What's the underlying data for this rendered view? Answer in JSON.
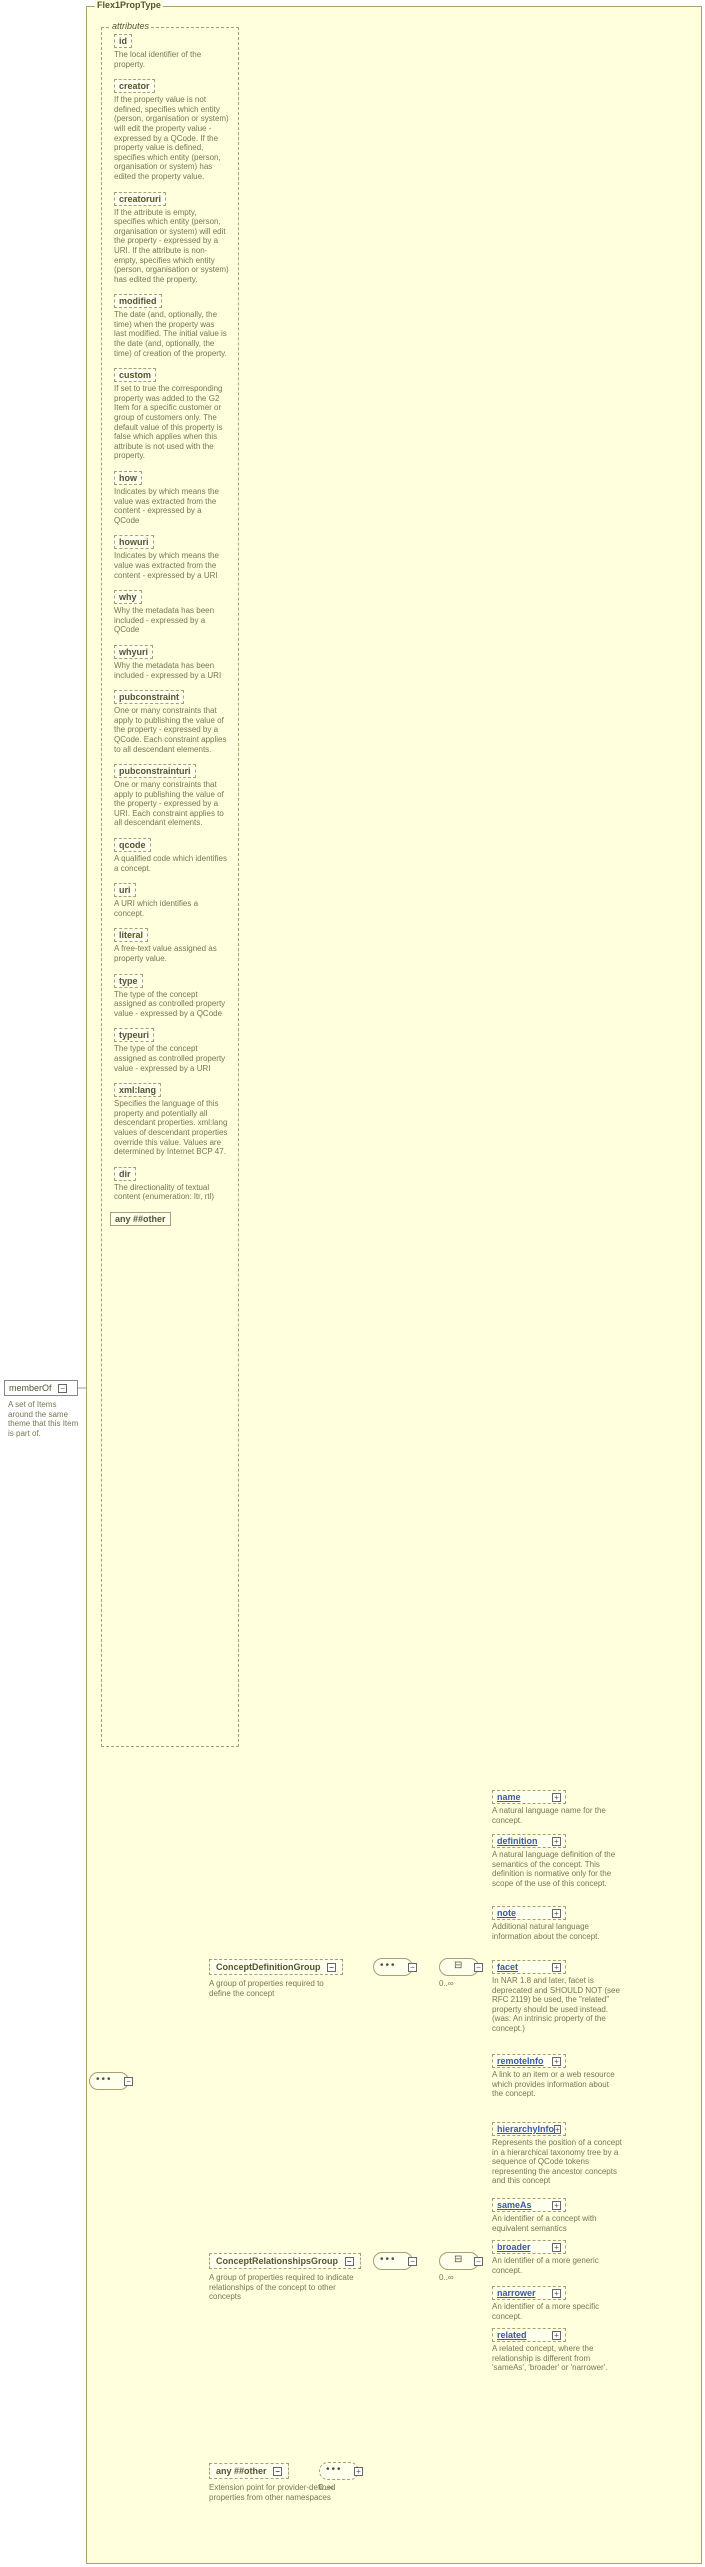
{
  "root": {
    "name": "memberOf",
    "desc": "A set of Items around the same theme that this Item is part of."
  },
  "panel": {
    "title": "Flex1PropType",
    "attributes_label": "attributes",
    "any_other": "any ##other",
    "attributes": [
      {
        "name": "id",
        "desc": "The local identifier of the property."
      },
      {
        "name": "creator",
        "desc": "If the property value is not defined, specifies which entity (person, organisation or system) will edit the property value - expressed by a QCode. If the property value is defined, specifies which entity (person, organisation or system) has edited the property value."
      },
      {
        "name": "creatoruri",
        "desc": "If the attribute is empty, specifies which entity (person, organisation or system) will edit the property - expressed by a URI. If the attribute is non-empty, specifies which entity (person, organisation or system) has edited the property."
      },
      {
        "name": "modified",
        "desc": "The date (and, optionally, the time) when the property was last modified. The initial value is the date (and, optionally, the time) of creation of the property."
      },
      {
        "name": "custom",
        "desc": "If set to true the corresponding property was added to the G2 Item for a specific customer or group of customers only. The default value of this property is false which applies when this attribute is not used with the property."
      },
      {
        "name": "how",
        "desc": "Indicates by which means the value was extracted from the content - expressed by a QCode"
      },
      {
        "name": "howuri",
        "desc": "Indicates by which means the value was extracted from the content - expressed by a URI"
      },
      {
        "name": "why",
        "desc": "Why the metadata has been included - expressed by a QCode"
      },
      {
        "name": "whyuri",
        "desc": "Why the metadata has been included - expressed by a URI"
      },
      {
        "name": "pubconstraint",
        "desc": "One or many constraints that apply to publishing the value of the property - expressed by a QCode. Each constraint applies to all descendant elements."
      },
      {
        "name": "pubconstrainturi",
        "desc": "One or many constraints that apply to publishing the value of the property - expressed by a URI. Each constraint applies to all descendant elements."
      },
      {
        "name": "qcode",
        "desc": "A qualified code which identifies a concept."
      },
      {
        "name": "uri",
        "desc": "A URI which identifies a concept."
      },
      {
        "name": "literal",
        "desc": "A free-text value assigned as property value."
      },
      {
        "name": "type",
        "desc": "The type of the concept assigned as controlled property value - expressed by a QCode"
      },
      {
        "name": "typeuri",
        "desc": "The type of the concept assigned as controlled property value - expressed by a URI"
      },
      {
        "name": "xml:lang",
        "desc": "Specifies the language of this property and potentially all descendant properties. xml:lang values of descendant properties override this value. Values are determined by Internet BCP 47."
      },
      {
        "name": "dir",
        "desc": "The directionality of textual content (enumeration: ltr, rtl)"
      }
    ]
  },
  "groups": {
    "def": {
      "name": "ConceptDefinitionGroup",
      "desc": "A group of properties required to define the concept"
    },
    "rel": {
      "name": "ConceptRelationshipsGroup",
      "desc": "A group of properties required to indicate relationships of the concept to other concepts"
    }
  },
  "ext": {
    "any": "any ##other",
    "desc": "Extension point for provider-defined properties from other namespaces"
  },
  "leaves": {
    "name": {
      "nm": "name",
      "desc": "A natural language name for the concept."
    },
    "definition": {
      "nm": "definition",
      "desc": "A natural language definition of the semantics of the concept. This definition is normative only for the scope of the use of this concept."
    },
    "note": {
      "nm": "note",
      "desc": "Additional natural language information about the concept."
    },
    "facet": {
      "nm": "facet",
      "desc": "In NAR 1.8 and later, facet is deprecated and SHOULD NOT (see RFC 2119) be used, the \"related\" property should be used instead. (was: An intrinsic property of the concept.)"
    },
    "remoteInfo": {
      "nm": "remoteInfo",
      "desc": "A link to an item or a web resource which provides information about the concept."
    },
    "hierarchyInfo": {
      "nm": "hierarchyInfo",
      "desc": "Represents the position of a concept in a hierarchical taxonomy tree by a sequence of QCode tokens representing the ancestor concepts and this concept"
    },
    "sameAs": {
      "nm": "sameAs",
      "desc": "An identifier of a concept with equivalent semantics"
    },
    "broader": {
      "nm": "broader",
      "desc": "An identifier of a more generic concept."
    },
    "narrower": {
      "nm": "narrower",
      "desc": "An identifier of a more specific concept."
    },
    "related": {
      "nm": "related",
      "desc": "A related concept, where the relationship is different from 'sameAs', 'broader' or 'narrower'."
    }
  },
  "card": {
    "zero_inf": "0..∞"
  }
}
